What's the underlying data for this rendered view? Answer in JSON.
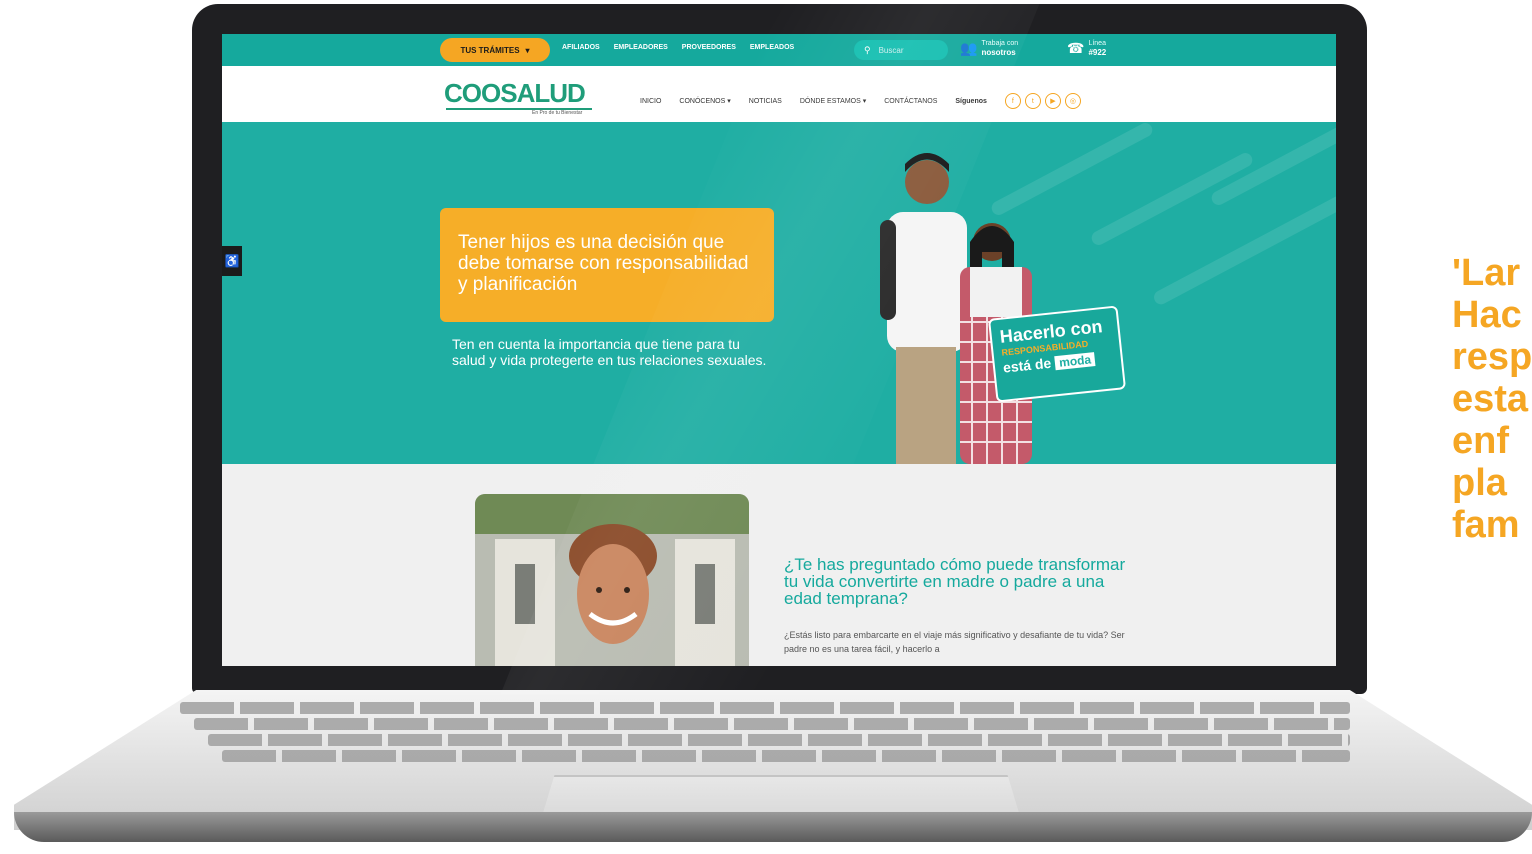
{
  "topbar": {
    "tramites_label": "TUS TRÁMITES",
    "nav_items": [
      "AFILIADOS",
      "EMPLEADORES",
      "PROVEEDORES",
      "EMPLEADOS"
    ],
    "search_placeholder": "Buscar",
    "trabaja_small": "Trabaja con",
    "trabaja_bold": "nosotros",
    "linea_small": "Línea",
    "linea_bold": "#922"
  },
  "header": {
    "logo_text": "COOSALUD",
    "logo_tagline": "En Pro de tu Bienestar",
    "menu": [
      "INICIO",
      "CONÓCENOS",
      "NOTICIAS",
      "DÓNDE ESTAMOS",
      "CONTÁCTANOS"
    ],
    "siguenos": "Síguenos"
  },
  "hero": {
    "title": "Tener hijos es una decisión que debe tomarse con responsabilidad y planificación",
    "subtitle": "Ten en cuenta la importancia que tiene para tu salud y vida protegerte en tus relaciones sexuales.",
    "badge_line1": "Hacerlo con",
    "badge_line2": "RESPONSABILIDAD",
    "badge_line3": "está de",
    "badge_line4": "moda"
  },
  "section": {
    "heading": "¿Te has preguntado cómo puede transformar tu vida convertirte en madre o padre a una edad temprana?",
    "paragraph": "¿Estás listo para embarcarte en el viaje más significativo y desafiante de tu vida? Ser padre no es una tarea fácil, y hacerlo a"
  },
  "side_caption": "'Lar\nHac\nresp\nesta\nenf\npla\nfam",
  "colors": {
    "teal": "#1faea3",
    "orange": "#f6ae28",
    "green_logo": "#1f9d7a"
  }
}
